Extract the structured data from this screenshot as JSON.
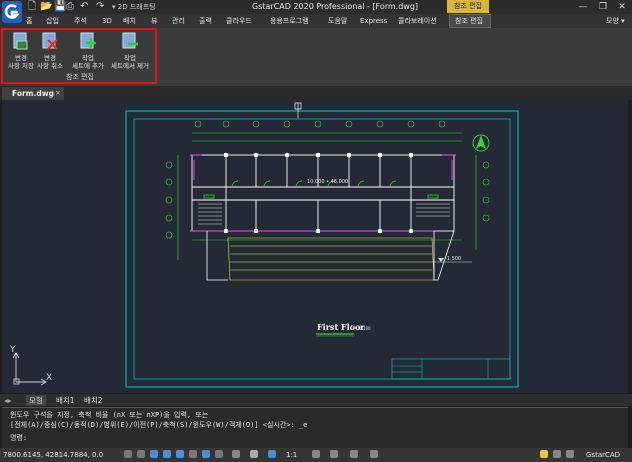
{
  "titlebar": {
    "title": "GstarCAD 2020 Professional - [Form.dwg]",
    "context_tab": "참조 편집",
    "quick_access_dropdown": "2D 드래프팅",
    "window_controls": [
      "—",
      "❐",
      "✕"
    ]
  },
  "menu": {
    "items": [
      "홈",
      "삽입",
      "주석",
      "3D",
      "배치",
      "뷰",
      "관리",
      "출력",
      "클라우드",
      "응용프로그램",
      "도움말",
      "Express",
      "콜라보레이션",
      "참조 편집"
    ],
    "right": "모양 ▾"
  },
  "ribbon": {
    "buttons": [
      {
        "label": "변경\n사항 저장"
      },
      {
        "label": "변경\n사항 취소"
      },
      {
        "label": "작업\n세트에 추가"
      },
      {
        "label": "작업\n세트에서 제거"
      }
    ],
    "group_label": "참조 편집"
  },
  "document": {
    "tab_label": "Form.dwg",
    "close": "×"
  },
  "drawing": {
    "area_label": "10,000 • 48,000",
    "elevation": "-1.500",
    "caption": "First Floor",
    "scale_caption": "1:100",
    "ucs": {
      "y": "Y",
      "x": "X"
    },
    "colors": {
      "background": "#232a35",
      "frame": "#00c8c8",
      "walls": "#ffffff",
      "accent": "#ff40ff",
      "green": "#3ad23a",
      "yellow": "#e6e64b"
    }
  },
  "layout_tabs": [
    "모형",
    "배치1",
    "배치2"
  ],
  "command": {
    "line1": "윈도우 구석을 지정, 축척 비율 (nX 또는 nXP)을 입력, 또는",
    "line2": "[전체(A)/중심(C)/동적(D)/범위(E)/이전(P)/축척(S)/윈도우(W)/객체(O)] <실시간>: _e",
    "prompt": "명령:"
  },
  "status": {
    "coords": "7800.6145, 42814.7884, 0.0",
    "zoom": "1:1",
    "brand": "GstarCAD"
  }
}
